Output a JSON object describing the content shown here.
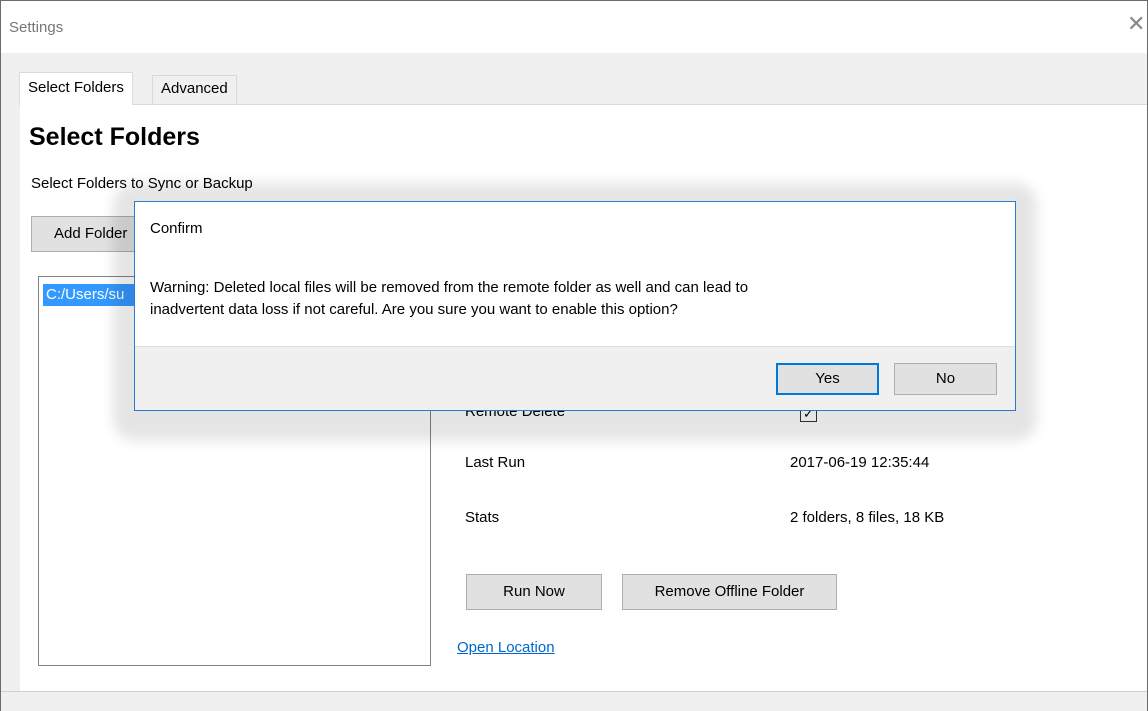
{
  "window": {
    "title": "Settings"
  },
  "tabs": [
    {
      "label": "Select Folders",
      "active": true
    },
    {
      "label": "Advanced",
      "active": false
    }
  ],
  "main": {
    "heading": "Select Folders",
    "subheading": "Select Folders to Sync or Backup",
    "add_folder_label": "Add Folder",
    "folder_list": [
      "C:/Users/su"
    ],
    "properties": [
      {
        "label": "Remote Delete",
        "checked": true
      },
      {
        "label": "Last Run",
        "value": "2017-06-19 12:35:44"
      },
      {
        "label": "Stats",
        "value": "2 folders, 8 files, 18 KB"
      }
    ],
    "run_now_label": "Run Now",
    "remove_offline_label": "Remove Offline Folder",
    "open_location_label": "Open Location"
  },
  "dialog": {
    "title": "Confirm",
    "message_line1": "Warning: Deleted local files will be removed from the remote folder as well and can lead to",
    "message_line2": "inadvertent data loss if not careful. Are you sure you want to enable this option?",
    "yes_label": "Yes",
    "no_label": "No"
  },
  "colors": {
    "accent": "#0078d7",
    "selection": "#3399ff",
    "link": "#0066cc"
  }
}
